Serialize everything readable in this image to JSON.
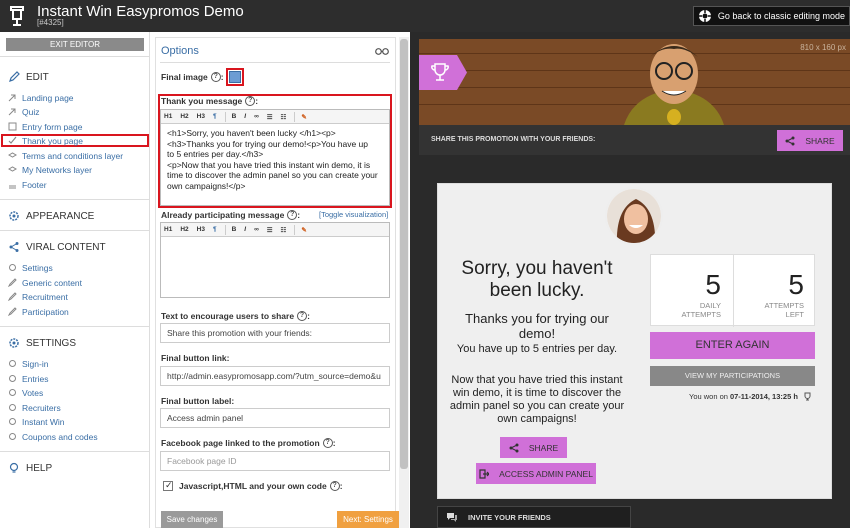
{
  "header": {
    "title": "Instant Win Easypromos Demo",
    "id": "[#4325]",
    "back_label": "Go back to classic editing mode"
  },
  "sidebar": {
    "exit_label": "EXIT EDITOR",
    "edit": {
      "title": "EDIT",
      "items": [
        {
          "label": "Landing page"
        },
        {
          "label": "Quiz"
        },
        {
          "label": "Entry form page"
        },
        {
          "label": "Thank you page"
        },
        {
          "label": "Terms and conditions layer"
        },
        {
          "label": "My Networks layer"
        },
        {
          "label": "Footer"
        }
      ]
    },
    "appearance": {
      "title": "APPEARANCE"
    },
    "viral": {
      "title": "VIRAL CONTENT",
      "items": [
        {
          "label": "Settings"
        },
        {
          "label": "Generic content"
        },
        {
          "label": "Recruitment"
        },
        {
          "label": "Participation"
        }
      ]
    },
    "settings": {
      "title": "SETTINGS",
      "items": [
        {
          "label": "Sign-in"
        },
        {
          "label": "Entries"
        },
        {
          "label": "Votes"
        },
        {
          "label": "Recruiters"
        },
        {
          "label": "Instant Win"
        },
        {
          "label": "Coupons and codes"
        }
      ]
    },
    "help": {
      "title": "HELP"
    }
  },
  "options": {
    "title": "Options",
    "final_image_label": "Final image",
    "thank_label": "Thank you message",
    "thank_lines": [
      "<h1>Sorry, you haven't been lucky </h1><p>",
      "<h3>Thanks you for trying our demo!<p>You have up",
      "to 5 entries per day.</h3>",
      "<p>Now that you have tried this instant win demo, it is",
      "time to discover the admin panel so you can create your",
      "own campaigns!</p>"
    ],
    "toolbar": {
      "h1": "H1",
      "h2": "H2",
      "h3": "H3",
      "para": "¶",
      "bold": "B",
      "italic": "I"
    },
    "already_label": "Already participating message",
    "toggle_label": "[Toggle visualization]",
    "encourage_label": "Text to encourage users to share",
    "encourage_value": "Share this promotion with your friends:",
    "final_link_label": "Final button link:",
    "final_link_value": "http://admin.easypromosapp.com/?utm_source=demo&u",
    "final_label_label": "Final button label:",
    "final_label_value": "Access admin panel",
    "fb_label": "Facebook page linked to the promotion",
    "fb_placeholder": "Facebook page ID",
    "code_label": "Javascript,HTML and your own code",
    "save_label": "Save changes",
    "next_label": "Next: Settings"
  },
  "preview": {
    "dim": "810 x 160 px",
    "share_text": "SHARE THIS PROMOTION WITH YOUR FRIENDS:",
    "share_btn": "SHARE",
    "h1": "Sorry, you haven't been lucky.",
    "h3": "Thanks you for trying our demo!",
    "p1": "You have up to 5 entries per day.",
    "p2": "Now that you have tried this instant win demo, it is time to discover the admin panel so you can create your own campaigns!",
    "daily_num": "5",
    "daily_cap1": "DAILY",
    "daily_cap2": "ATTEMPTS",
    "left_num": "5",
    "left_cap1": "ATTEMPTS",
    "left_cap2": "LEFT",
    "enter_again": "ENTER AGAIN",
    "view_part": "VIEW MY PARTICIPATIONS",
    "won_prefix": "You won on",
    "won_date": "07-11-2014, 13:25 h",
    "share2": "SHARE",
    "access": "ACCESS ADMIN PANEL",
    "invite": "INVITE YOUR FRIENDS"
  },
  "colors": {
    "accent": "#d070d8",
    "highlight": "#d9151e",
    "link": "#3a6ea5"
  }
}
